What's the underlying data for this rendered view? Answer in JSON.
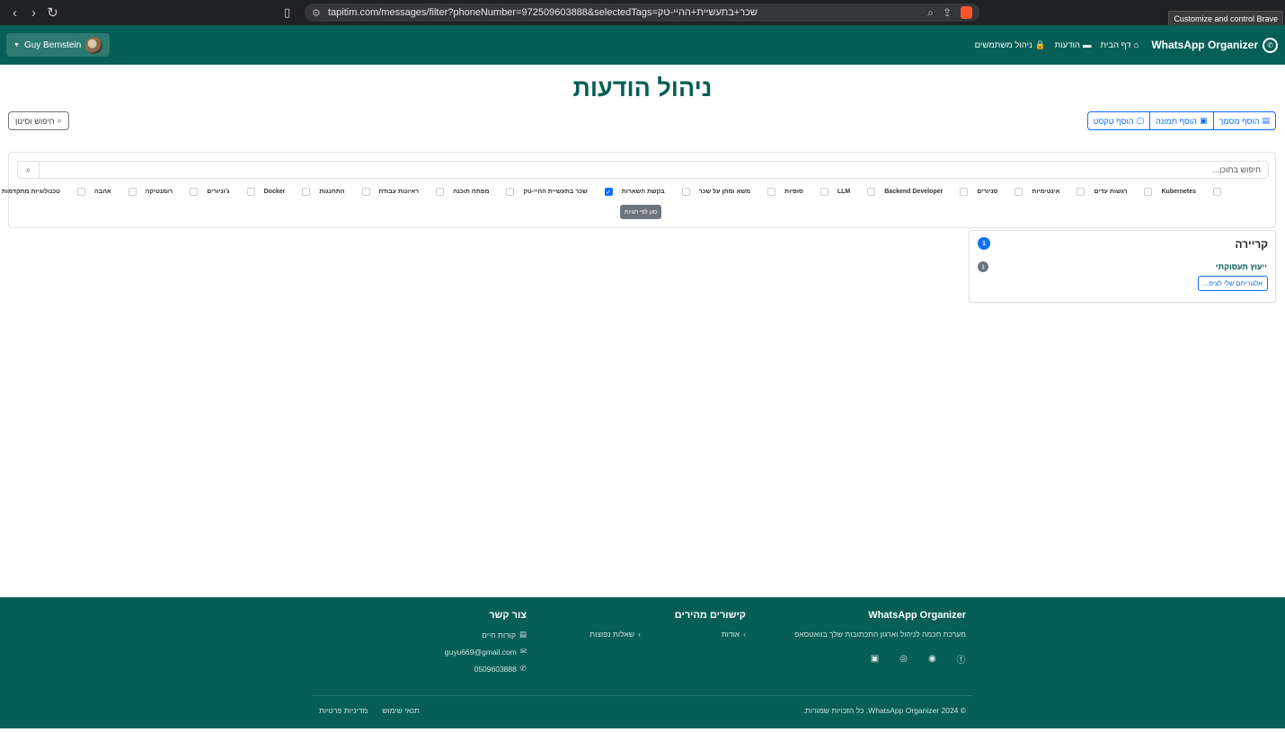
{
  "browser": {
    "url": "tapitim.com/messages/filter?phoneNumber=972509603888&selectedTags=שכר+בתעשיית+ההיי-טק",
    "tooltip": "Customize and control Brave"
  },
  "navbar": {
    "brand": "WhatsApp Organizer",
    "links": [
      "דף הבית",
      "הודעות",
      "ניהול משתמשים"
    ],
    "user_name": "Guy Bernstein"
  },
  "page": {
    "title": "ניהול הודעות",
    "search_filter_label": "חיפוש וסינון",
    "add_buttons": [
      "הוסף מסמך",
      "הוסף תמונה",
      "הוסף טקסט"
    ]
  },
  "filter": {
    "search_placeholder": "חיפוש בתוכן...",
    "tags": [
      {
        "label": "Kubernetes",
        "checked": false
      },
      {
        "label": "רגשות עדים",
        "checked": false
      },
      {
        "label": "אינטימיות",
        "checked": false
      },
      {
        "label": "סניורים",
        "checked": false
      },
      {
        "label": "Backend Developer",
        "checked": false
      },
      {
        "label": "LLM",
        "checked": false
      },
      {
        "label": "סופיות",
        "checked": false
      },
      {
        "label": "משא ומתן על שכר",
        "checked": false
      },
      {
        "label": "בקשת השארות",
        "checked": false
      },
      {
        "label": "שכר בתעשיית ההיי-טק",
        "checked": true
      },
      {
        "label": "מפתח תוכנה",
        "checked": false
      },
      {
        "label": "ראיונות עבודה",
        "checked": false
      },
      {
        "label": "התחנגות",
        "checked": false
      },
      {
        "label": "Docker",
        "checked": false
      },
      {
        "label": "ג'וניורים",
        "checked": false
      },
      {
        "label": "רומנטיקה",
        "checked": false
      },
      {
        "label": "אהבה",
        "checked": false
      },
      {
        "label": "טכנולוגיות מתקדמות",
        "checked": false
      }
    ],
    "filter_button": "סנן לפי תגיות"
  },
  "category": {
    "title": "קריירה",
    "count": "1",
    "sub_title": "ייעוץ תעסוקתי",
    "sub_count": "1",
    "message_button": "אלגוריתם שלי לציפ..."
  },
  "footer": {
    "brand": "WhatsApp Organizer",
    "tagline": "מערכת חכמה לניהול וארגון התכתובות שלך בוואטסאפ",
    "quick_links_title": "קישורים מהירים",
    "quick_links": [
      "אודות",
      "שאלות נפוצות"
    ],
    "contact_title": "צור קשר",
    "contact_cv": "קורות חיים",
    "contact_email": "guyu669@gmail.com",
    "contact_phone": "0509603888",
    "copyright": "© 2024 WhatsApp Organizer. כל הזכויות שמורות.",
    "legal": [
      "תנאי שימוש",
      "מדיניות פרטיות"
    ]
  },
  "colors": {
    "brand_green": "#075e54",
    "primary_blue": "#0d6efd",
    "secondary_gray": "#6c757d"
  }
}
